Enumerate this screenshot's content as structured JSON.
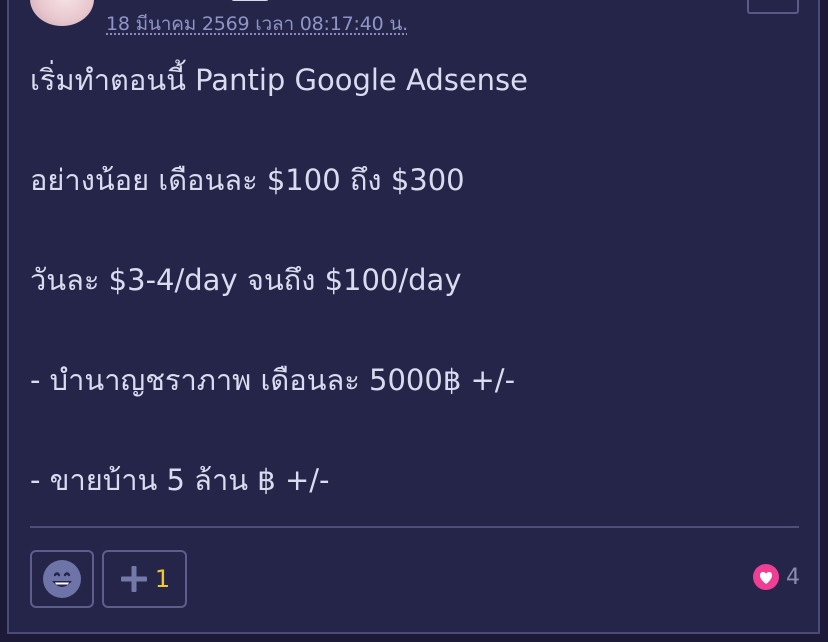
{
  "post": {
    "timestamp": "18 มีนาคม 2569 เวลา 08:17:40 น.",
    "lines": [
      "เริ่มทำตอนนี้ Pantip Google Adsense",
      "อย่างน้อย เดือนละ $100 ถึง $300",
      "วันละ $3-4/day จนถึง $100/day",
      "- บำนาญชราภาพ เดือนละ 5000฿ +/-",
      "- ขายบ้าน 5 ล้าน ฿ +/-"
    ]
  },
  "actions": {
    "emoji_icon": "smiley-face-icon",
    "plus_icon": "plus-icon",
    "plus_count": "1",
    "heart_icon": "heart-icon",
    "heart_count": "4"
  },
  "colors": {
    "background": "#25254a",
    "text": "#d9dcee",
    "timestamp": "#8e95c6",
    "plus_count": "#f2c72a",
    "heart": "#ee3f95"
  }
}
